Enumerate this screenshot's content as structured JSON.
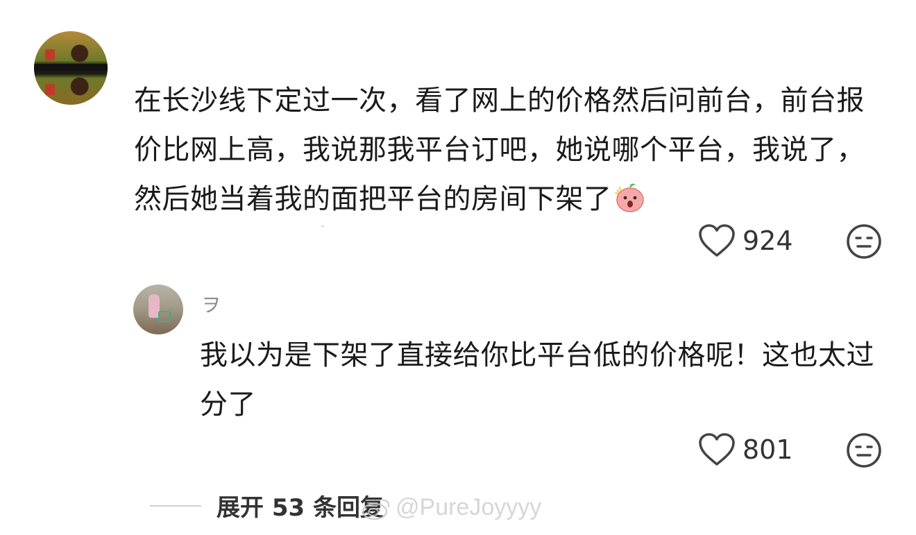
{
  "comment": {
    "text": "在长沙线下定过一次，看了网上的价格然后问前台，前台报价比网上高，我说那我平台订吧，她说哪个平台，我说了，然后她当着我的面把平台的房间下架了",
    "emoji": "shocked-peach-emoji",
    "likes": "924"
  },
  "reply": {
    "username": "ヲ",
    "text": "我以为是下架了直接给你比平台低的价格呢！这也太过分了",
    "likes": "801"
  },
  "expand": {
    "label": "展开 53 条回复"
  },
  "watermark": {
    "text": "@PureJoyyyy"
  },
  "icons": {
    "like": "heart-outline-icon",
    "reaction": "meh-face-icon",
    "watermark": "weibo-logo-icon"
  },
  "colors": {
    "text": "#1a1a1a",
    "muted": "#8c8c8c",
    "icon": "#444444"
  }
}
